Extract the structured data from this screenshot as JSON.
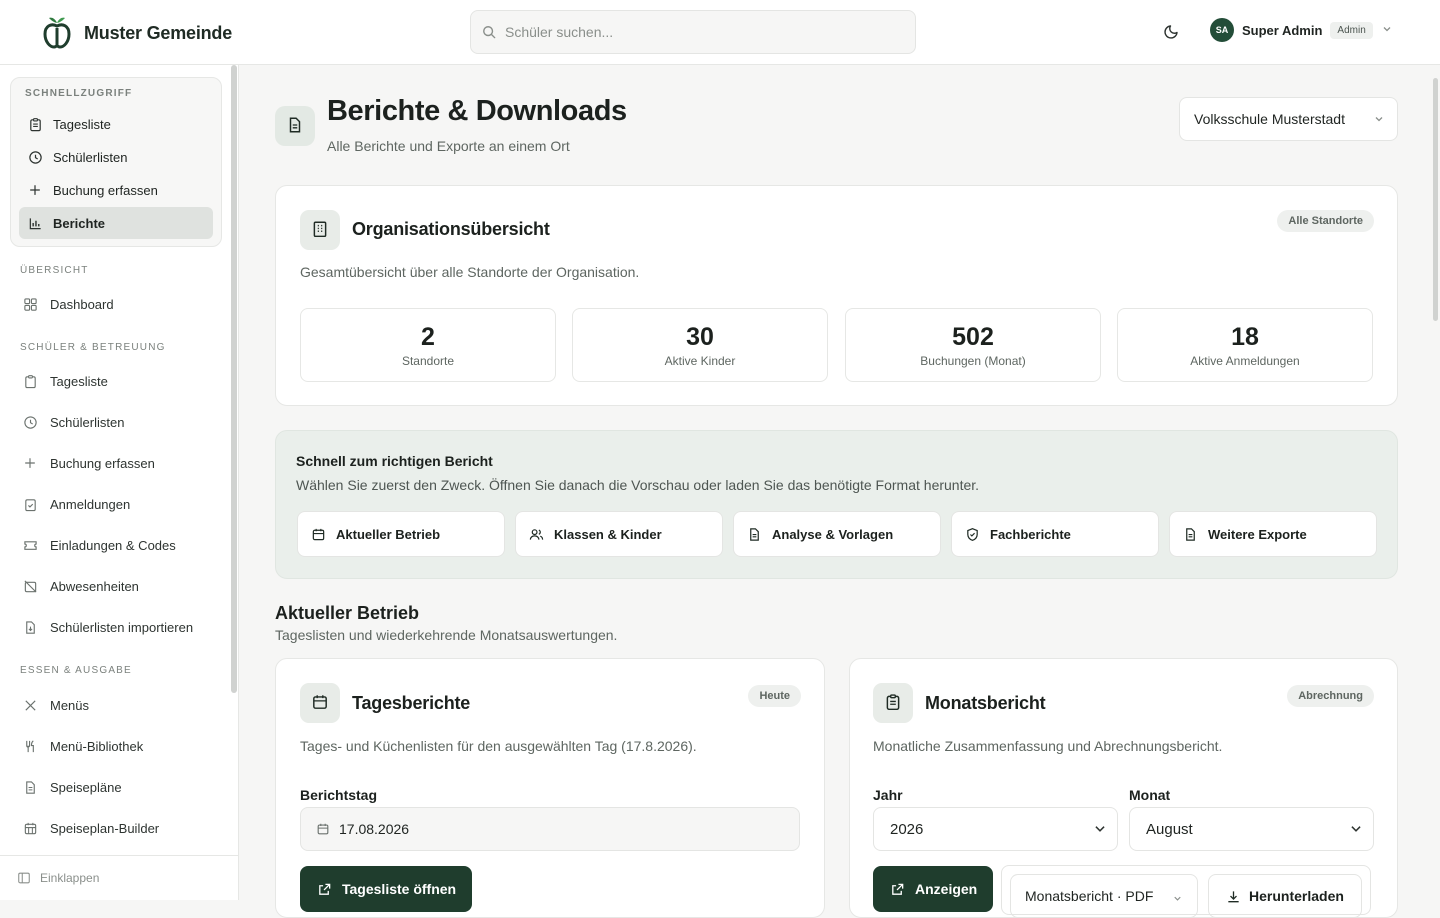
{
  "app": {
    "name": "Muster Gemeinde",
    "search_placeholder": "Schüler suchen...",
    "user_initials": "SA",
    "user_name": "Super Admin",
    "user_role": "Admin"
  },
  "sidebar": {
    "quick_title": "SCHNELLZUGRIFF",
    "quick_items": [
      {
        "label": "Tagesliste",
        "icon": "clipboard-icon"
      },
      {
        "label": "Schülerlisten",
        "icon": "clock-icon"
      },
      {
        "label": "Buchung erfassen",
        "icon": "plus-icon"
      },
      {
        "label": "Berichte",
        "icon": "bar-chart-icon",
        "active": true
      }
    ],
    "overview_title": "ÜBERSICHT",
    "overview_items": [
      {
        "label": "Dashboard",
        "icon": "grid-icon"
      }
    ],
    "students_title": "SCHÜLER & BETREUUNG",
    "students_items": [
      {
        "label": "Tagesliste",
        "icon": "clipboard-icon"
      },
      {
        "label": "Schülerlisten",
        "icon": "clock-icon"
      },
      {
        "label": "Buchung erfassen",
        "icon": "plus-icon"
      },
      {
        "label": "Anmeldungen",
        "icon": "clipboard-check-icon"
      },
      {
        "label": "Einladungen & Codes",
        "icon": "ticket-icon"
      },
      {
        "label": "Abwesenheiten",
        "icon": "calendar-off-icon"
      },
      {
        "label": "Schülerlisten importieren",
        "icon": "file-import-icon"
      }
    ],
    "food_title": "ESSEN & AUSGABE",
    "food_items": [
      {
        "label": "Menüs",
        "icon": "utensils-crossed-icon"
      },
      {
        "label": "Menü-Bibliothek",
        "icon": "utensils-icon"
      },
      {
        "label": "Speisepläne",
        "icon": "file-text-icon"
      },
      {
        "label": "Speiseplan-Builder",
        "icon": "calendar-grid-icon"
      }
    ],
    "collapse_label": "Einklappen"
  },
  "header": {
    "title": "Berichte & Downloads",
    "subtitle": "Alle Berichte und Exporte an einem Ort",
    "school_select": "Volksschule Musterstadt"
  },
  "org": {
    "title": "Organisationsübersicht",
    "badge": "Alle Standorte",
    "description": "Gesamtübersicht über alle Standorte der Organisation.",
    "stats": [
      {
        "value": "2",
        "label": "Standorte"
      },
      {
        "value": "30",
        "label": "Aktive Kinder"
      },
      {
        "value": "502",
        "label": "Buchungen (Monat)"
      },
      {
        "value": "18",
        "label": "Aktive Anmeldungen"
      }
    ]
  },
  "guide": {
    "title": "Schnell zum richtigen Bericht",
    "description": "Wählen Sie zuerst den Zweck. Öffnen Sie danach die Vorschau oder laden Sie das benötigte Format herunter.",
    "buttons": [
      {
        "label": "Aktueller Betrieb",
        "icon": "calendar-icon"
      },
      {
        "label": "Klassen & Kinder",
        "icon": "users-icon"
      },
      {
        "label": "Analyse & Vorlagen",
        "icon": "file-text-icon"
      },
      {
        "label": "Fachberichte",
        "icon": "shield-check-icon"
      },
      {
        "label": "Weitere Exporte",
        "icon": "file-text-icon"
      }
    ]
  },
  "section": {
    "title": "Aktueller Betrieb",
    "subtitle": "Tageslisten und wiederkehrende Monatsauswertungen."
  },
  "daily": {
    "title": "Tagesberichte",
    "badge": "Heute",
    "description": "Tages- und Küchenlisten für den ausgewählten Tag (17.8.2026).",
    "date_label": "Berichtstag",
    "date_value": "17.08.2026",
    "button": "Tagesliste öffnen"
  },
  "monthly": {
    "title": "Monatsbericht",
    "badge": "Abrechnung",
    "description": "Monatliche Zusammenfassung und Abrechnungsbericht.",
    "year_label": "Jahr",
    "year_value": "2026",
    "month_label": "Monat",
    "month_value": "August",
    "show_button": "Anzeigen",
    "format_value": "Monatsbericht · PDF",
    "download_button": "Herunterladen"
  },
  "colors": {
    "brand": "#1f3d2d",
    "accent_bg": "#eaefeb"
  }
}
